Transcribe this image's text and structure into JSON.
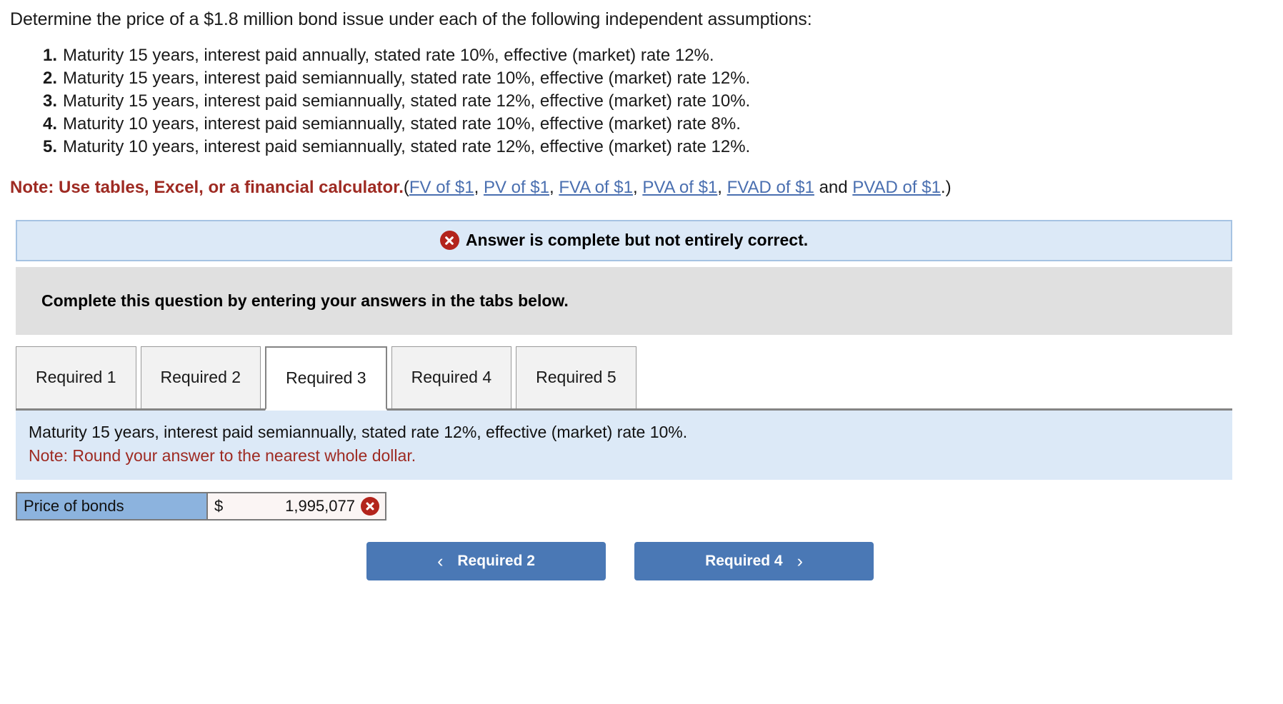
{
  "intro": "Determine the price of a $1.8 million bond issue under each of the following independent assumptions:",
  "assumptions": [
    "Maturity 15 years, interest paid annually, stated rate 10%, effective (market) rate 12%.",
    "Maturity 15 years, interest paid semiannually, stated rate 10%, effective (market) rate 12%.",
    "Maturity 15 years, interest paid semiannually, stated rate 12%, effective (market) rate 10%.",
    "Maturity 10 years, interest paid semiannually, stated rate 10%, effective (market) rate 8%.",
    "Maturity 10 years, interest paid semiannually, stated rate 12%, effective (market) rate 12%."
  ],
  "note": {
    "bold_text": "Note: Use tables, Excel, or a financial calculator.",
    "open_paren": "(",
    "links": [
      "FV of $1",
      "PV of $1",
      "FVA of $1",
      "PVA of $1",
      "FVAD of $1",
      "PVAD of $1"
    ],
    "comma": ", ",
    "and_text": " and ",
    "close_paren": ".)"
  },
  "status": {
    "icon": "error-x-circle-icon",
    "text": "Answer is complete but not entirely correct.",
    "bg_color": "#dce9f7",
    "border_color": "#a6c3e3",
    "icon_color": "#b3241c"
  },
  "instruction": {
    "text": "Complete this question by entering your answers in the tabs below.",
    "bg_color": "#e0e0e0"
  },
  "tabs": [
    {
      "label": "Required 1",
      "active": false
    },
    {
      "label": "Required 2",
      "active": false
    },
    {
      "label": "Required 3",
      "active": true
    },
    {
      "label": "Required 4",
      "active": false
    },
    {
      "label": "Required 5",
      "active": false
    }
  ],
  "question": {
    "prompt": "Maturity 15 years, interest paid semiannually, stated rate 12%, effective (market) rate 10%.",
    "note": "Note: Round your answer to the nearest whole dollar.",
    "note_color": "#9e2a22",
    "bg_color": "#dce9f7"
  },
  "answer": {
    "label": "Price of bonds",
    "currency": "$",
    "value": "1,995,077",
    "status_icon": "error-x-circle-icon",
    "label_bg": "#8cb3de",
    "value_bg": "#fbf5f4"
  },
  "nav": {
    "prev_chevron": "‹",
    "prev_label": "Required 2",
    "next_label": "Required 4",
    "next_chevron": "›",
    "button_color": "#4a78b5"
  }
}
